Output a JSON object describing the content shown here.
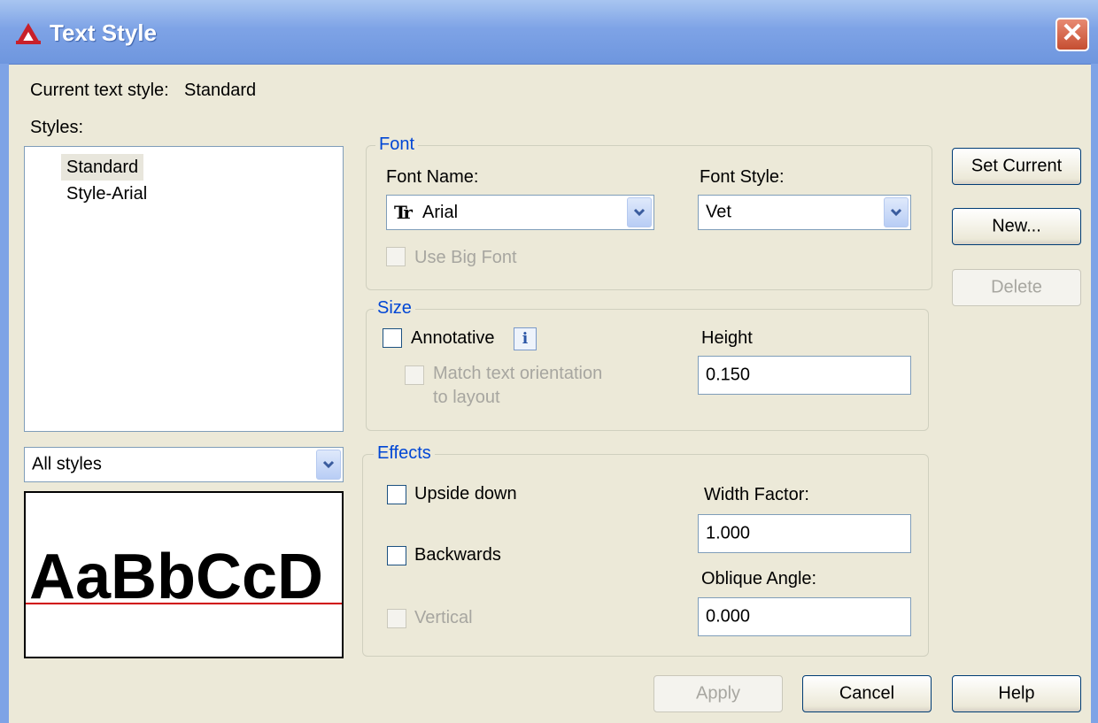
{
  "window": {
    "title": "Text Style",
    "close_glyph": "✕"
  },
  "current_style": {
    "label": "Current text style:",
    "value": "Standard"
  },
  "styles": {
    "label": "Styles:",
    "items": [
      {
        "label": "Standard",
        "selected": true
      },
      {
        "label": "Style-Arial",
        "selected": false
      }
    ],
    "filter_value": "All styles"
  },
  "preview": {
    "sample_text": "AaBbCcD"
  },
  "font_group": {
    "title": "Font",
    "font_name_label": "Font Name:",
    "font_name_value": "Arial",
    "font_name_icon_glyph": "Tr",
    "font_style_label": "Font Style:",
    "font_style_value": "Vet",
    "use_big_font_label": "Use Big Font"
  },
  "size_group": {
    "title": "Size",
    "annotative_label": "Annotative",
    "info_glyph": "i",
    "match_orientation_line1": "Match text orientation",
    "match_orientation_line2": "to layout",
    "height_label": "Height",
    "height_value": "0.150"
  },
  "effects_group": {
    "title": "Effects",
    "upside_down_label": "Upside down",
    "backwards_label": "Backwards",
    "vertical_label": "Vertical",
    "width_factor_label": "Width Factor:",
    "width_factor_value": "1.000",
    "oblique_angle_label": "Oblique Angle:",
    "oblique_angle_value": "0.000"
  },
  "buttons": {
    "set_current": "Set Current",
    "new": "New...",
    "delete": "Delete",
    "apply": "Apply",
    "cancel": "Cancel",
    "help": "Help"
  },
  "colors": {
    "title_bar": "#7ea3e6",
    "group_title": "#0046d5",
    "dialog_bg": "#ece9d8",
    "baseline": "#d00000"
  }
}
